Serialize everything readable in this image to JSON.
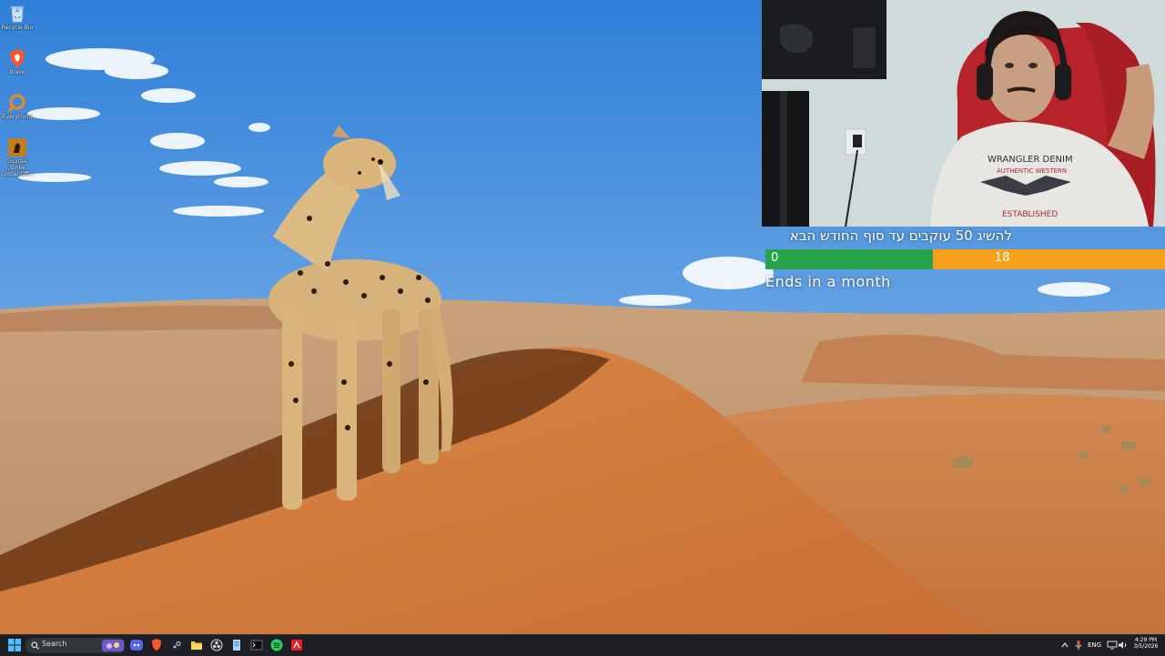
{
  "desktop": {
    "icons": [
      {
        "label": "Recycle Bin",
        "icon": "recycle-bin-icon"
      },
      {
        "label": "Brave",
        "icon": "brave-icon"
      },
      {
        "label": "Everything",
        "icon": "everything-icon"
      },
      {
        "label": "Counter-Strike Global Off...",
        "icon": "counter-strike-icon"
      }
    ]
  },
  "webcam": {
    "shirt_line1": "WRANGLER DENIM",
    "shirt_line2": "AUTHENTIC WESTERN",
    "shirt_line3": "ESTABLISHED"
  },
  "goal": {
    "title": "להשיג 50 עוקבים עד סוף החודש הבא",
    "current": "0",
    "target": "18",
    "progress_fraction": 0.42,
    "ends": "Ends in a month",
    "colors": {
      "fill": "#28a34a",
      "remaining": "#f7a11a"
    }
  },
  "taskbar": {
    "search_label": "Search",
    "apps": [
      "start-icon",
      "discord-icon",
      "brave-icon",
      "steam-icon",
      "file-explorer-icon",
      "spotify-icon",
      "amd-icon"
    ],
    "tray": {
      "language": "ENG",
      "time": "4:29 PM",
      "date": "3/5/2026"
    }
  }
}
